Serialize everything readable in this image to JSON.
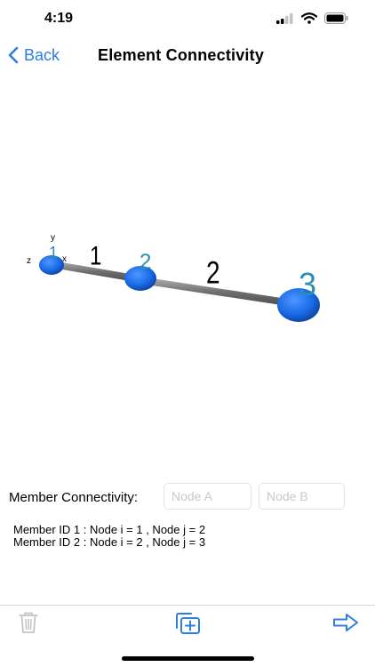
{
  "status_bar": {
    "time": "4:19"
  },
  "nav": {
    "back_label": "Back",
    "title": "Element Connectivity"
  },
  "model": {
    "axes": {
      "x": "x",
      "y": "y",
      "z": "z"
    },
    "nodes": [
      {
        "label": "1"
      },
      {
        "label": "2"
      },
      {
        "label": "3"
      }
    ],
    "members": [
      {
        "label": "1"
      },
      {
        "label": "2"
      }
    ],
    "colors": {
      "node": "#1a6be8",
      "node_label": "#2a8fb0",
      "member": "#8a8a8a",
      "member_label": "#000000"
    }
  },
  "connectivity": {
    "label": "Member Connectivity:",
    "node_a_placeholder": "Node A",
    "node_b_placeholder": "Node B"
  },
  "members_list": [
    "Member ID 1 : Node i = 1 , Node j = 2",
    "Member ID 2 : Node i = 2 , Node j = 3"
  ],
  "toolbar": {
    "icons": [
      "trash-icon",
      "add-copy-icon",
      "arrow-right-icon"
    ]
  },
  "accent_color": "#2f7de1"
}
